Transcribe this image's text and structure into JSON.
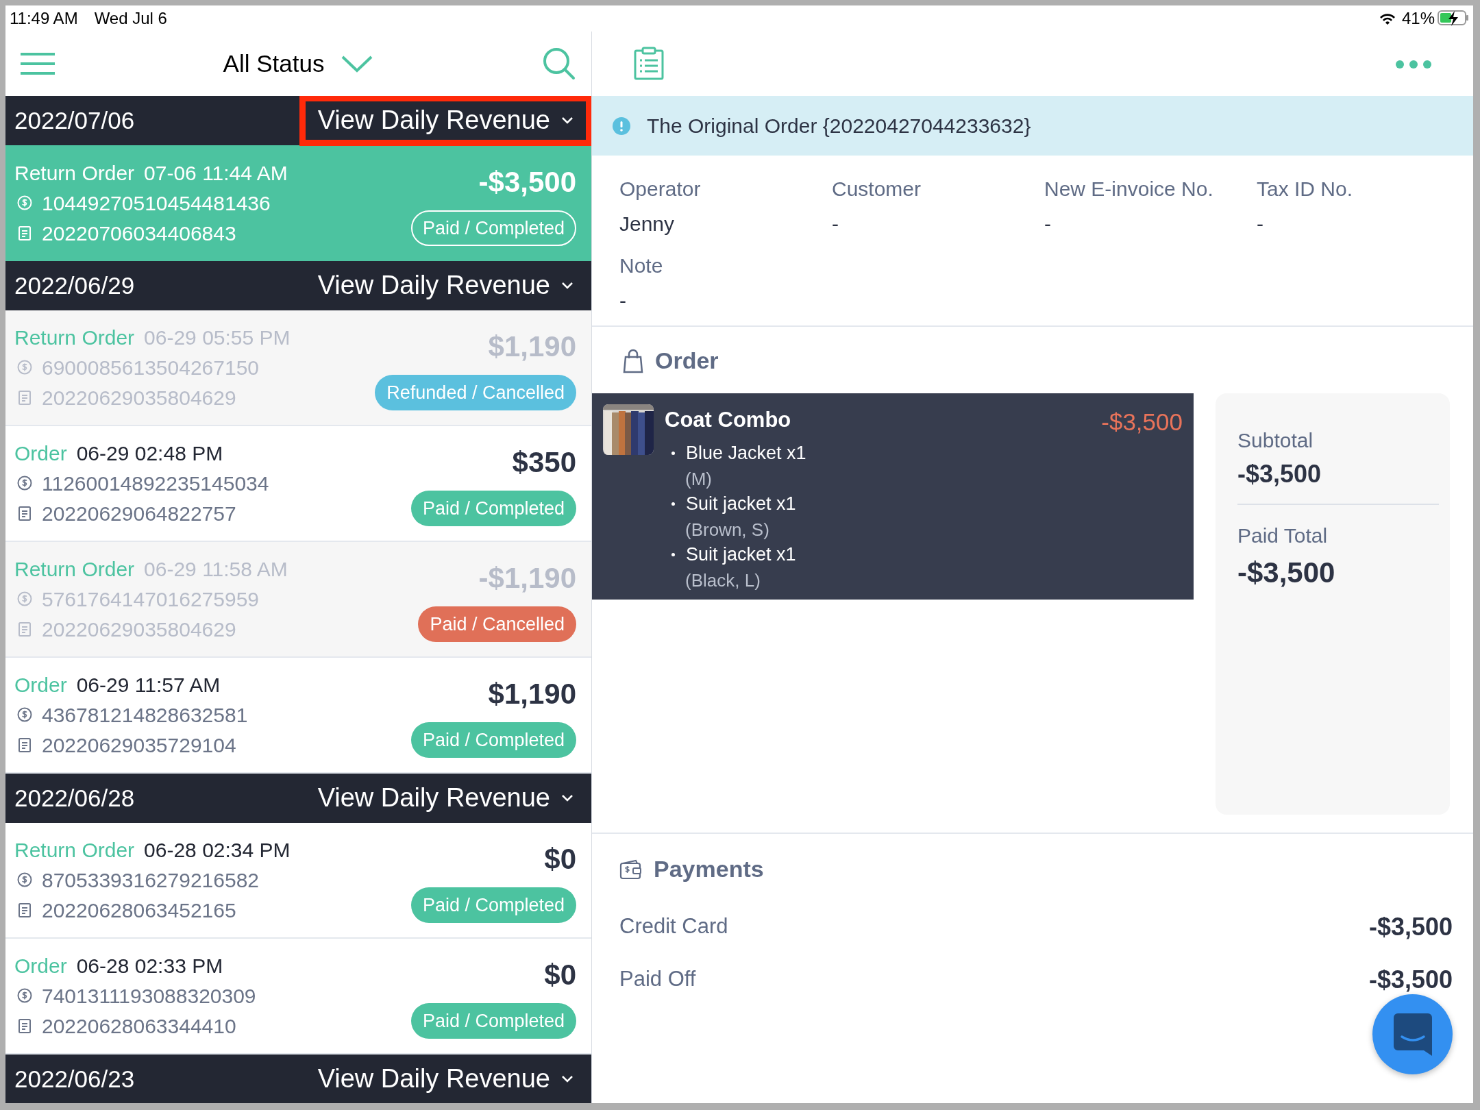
{
  "status_bar": {
    "time": "11:49 AM",
    "date": "Wed Jul 6",
    "battery": "41%"
  },
  "list_toolbar": {
    "filter": "All Status"
  },
  "days": [
    {
      "date": "2022/07/06",
      "revenue_button": "View Daily Revenue",
      "highlighted": true,
      "orders": [
        {
          "type_label": "Return Order",
          "time": "07-06 11:44 AM",
          "payment_no": "1044927051045448143​6",
          "invoice_no": "20220706034406843",
          "amount": "-$3,500",
          "status": "Paid / Completed",
          "selected": true,
          "dimmed": false
        }
      ]
    },
    {
      "date": "2022/06/29",
      "revenue_button": "View Daily Revenue",
      "highlighted": false,
      "orders": [
        {
          "type_label": "Return Order",
          "time": "06-29 05:55 PM",
          "payment_no": "6900085613504267150",
          "invoice_no": "20220629035804629",
          "amount": "$1,190",
          "status": "Refunded / Cancelled",
          "color": "#5bc0de",
          "selected": false,
          "dimmed": true
        },
        {
          "type_label": "Order",
          "time": "06-29 02:48 PM",
          "payment_no": "1126001489223514503​4",
          "invoice_no": "20220629064822757",
          "amount": "$350",
          "status": "Paid / Completed",
          "color": "#4cc3a0",
          "selected": false,
          "dimmed": false
        },
        {
          "type_label": "Return Order",
          "time": "06-29 11:58 AM",
          "payment_no": "5761764147016275959",
          "invoice_no": "20220629035804629",
          "amount": "-$1,190",
          "status": "Paid / Cancelled",
          "color": "#e07058",
          "selected": false,
          "dimmed": true
        },
        {
          "type_label": "Order",
          "time": "06-29 11:57 AM",
          "payment_no": "4367812148286325​81",
          "invoice_no": "20220629035729104",
          "amount": "$1,190",
          "status": "Paid / Completed",
          "color": "#4cc3a0",
          "selected": false,
          "dimmed": false
        }
      ]
    },
    {
      "date": "2022/06/28",
      "revenue_button": "View Daily Revenue",
      "highlighted": false,
      "orders": [
        {
          "type_label": "Return Order",
          "time": "06-28 02:34 PM",
          "payment_no": "8705339316279216582",
          "invoice_no": "20220628063452165",
          "amount": "$0",
          "status": "Paid / Completed",
          "color": "#4cc3a0",
          "selected": false,
          "dimmed": false
        },
        {
          "type_label": "Order",
          "time": "06-28 02:33 PM",
          "payment_no": "7401311193088320309",
          "invoice_no": "20220628063344410",
          "amount": "$0",
          "status": "Paid / Completed",
          "color": "#4cc3a0",
          "selected": false,
          "dimmed": false
        }
      ]
    },
    {
      "date": "2022/06/23",
      "revenue_button": "View Daily Revenue",
      "highlighted": false
    }
  ],
  "detail": {
    "banner": "The Original Order {20220427044233632}",
    "fields": [
      {
        "label": "Operator",
        "value": "Jenny"
      },
      {
        "label": "Customer",
        "value": "-"
      },
      {
        "label": "New E-invoice No.",
        "value": "-"
      },
      {
        "label": "Tax ID No.",
        "value": "-"
      },
      {
        "label": "Note",
        "value": "-"
      }
    ],
    "order": {
      "heading": "Order",
      "items": [
        {
          "name": "Coat Combo",
          "price": "-$3,500",
          "components": [
            {
              "name": "Blue Jacket x1",
              "variant": "(M)"
            },
            {
              "name": "Suit jacket x1",
              "variant": "(Brown, S)"
            },
            {
              "name": "Suit jacket x1",
              "variant": "(Black, L)"
            }
          ]
        }
      ],
      "summary": [
        {
          "label": "Subtotal",
          "value": "-$3,500"
        },
        {
          "label": "Paid Total",
          "value": "-$3,500"
        }
      ]
    },
    "payments": {
      "heading": "Payments",
      "rows": [
        {
          "label": "Credit Card",
          "amount": "-$3,500"
        },
        {
          "label": "Paid Off",
          "amount": "-$3,500"
        }
      ]
    }
  }
}
